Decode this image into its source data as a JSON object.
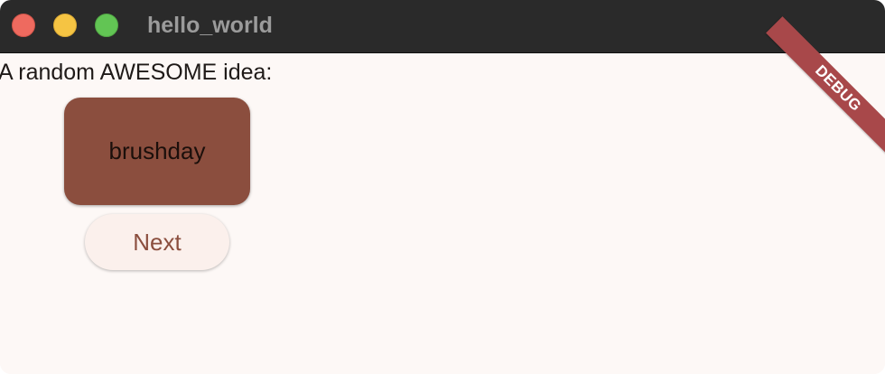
{
  "window": {
    "title": "hello_world",
    "traffic_lights": {
      "close_color": "#ee6a5f",
      "minimize_color": "#f5c443",
      "maximize_color": "#62c554"
    }
  },
  "main": {
    "prompt": "A random AWESOME idea:",
    "idea": "brushday",
    "next_label": "Next"
  },
  "debug_banner": {
    "label": "DEBUG",
    "color": "#a8484a"
  },
  "colors": {
    "accent": "#8b4e3e",
    "background": "#fdf8f6"
  }
}
